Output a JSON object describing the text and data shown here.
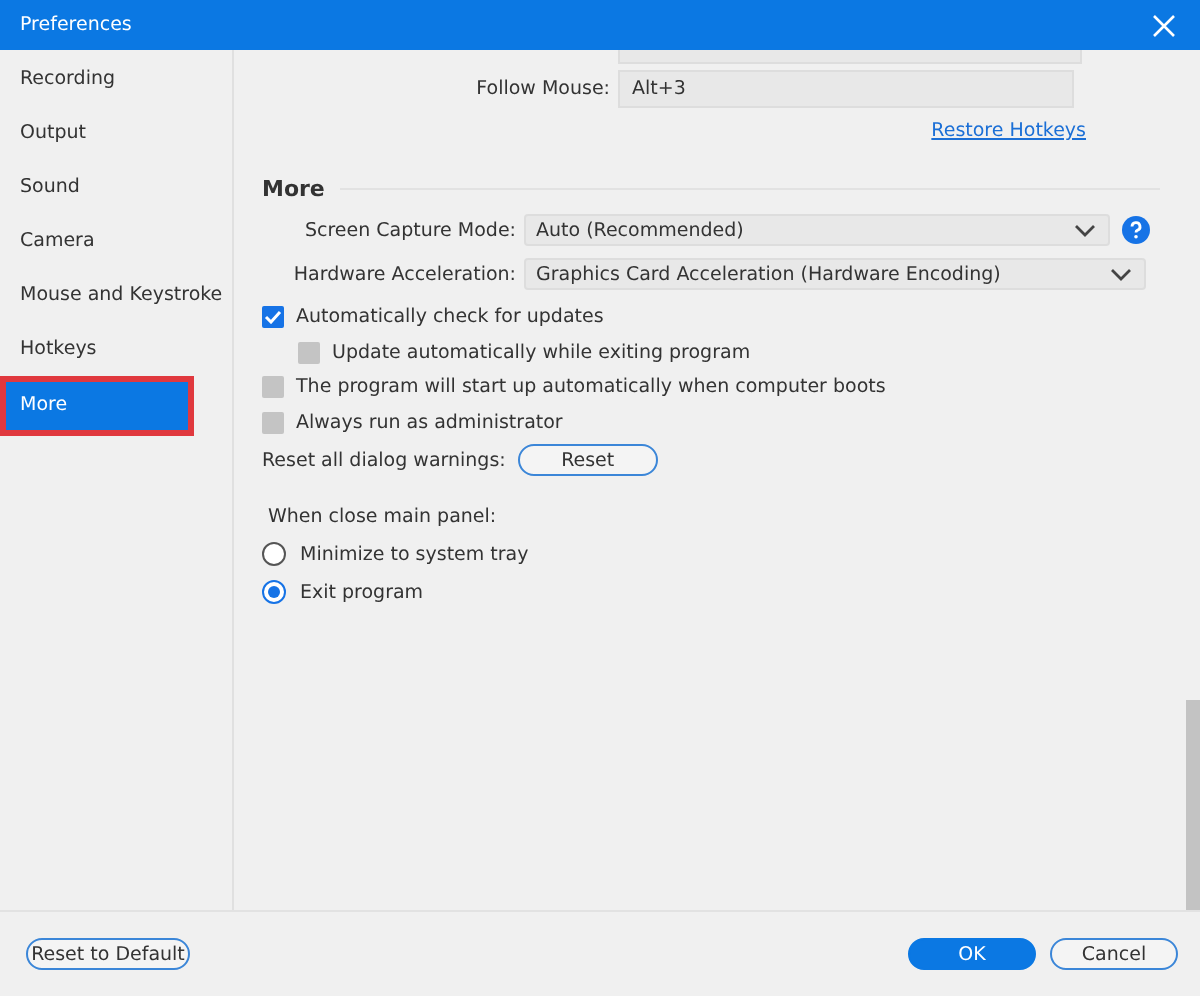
{
  "window": {
    "title": "Preferences"
  },
  "sidebar": {
    "items": [
      {
        "label": "Recording",
        "selected": false
      },
      {
        "label": "Output",
        "selected": false
      },
      {
        "label": "Sound",
        "selected": false
      },
      {
        "label": "Camera",
        "selected": false
      },
      {
        "label": "Mouse and Keystroke",
        "selected": false
      },
      {
        "label": "Hotkeys",
        "selected": false
      },
      {
        "label": "More",
        "selected": true
      }
    ]
  },
  "hotkeys": {
    "follow_mouse": {
      "label": "Follow Mouse:",
      "value": "Alt+3"
    },
    "restore_link": "Restore Hotkeys"
  },
  "more": {
    "heading": "More",
    "dropdowns": [
      {
        "label": "Screen Capture Mode:",
        "value": "Auto (Recommended)",
        "help": true
      },
      {
        "label": "Hardware Acceleration:",
        "value": "Graphics Card Acceleration (Hardware Encoding)",
        "help": false
      }
    ],
    "checkboxes": [
      {
        "label": "Automatically check for updates",
        "checked": true,
        "children": [
          {
            "label": "Update automatically while exiting program",
            "checked": false
          }
        ]
      },
      {
        "label": "The program will start up automatically when computer boots",
        "checked": false
      },
      {
        "label": "Always run as administrator",
        "checked": false
      }
    ],
    "reset_warnings": {
      "label": "Reset all dialog warnings:",
      "button": "Reset"
    },
    "close_label": "When close main panel:",
    "radios": [
      {
        "label": "Minimize to system tray",
        "selected": false
      },
      {
        "label": "Exit program",
        "selected": true
      }
    ]
  },
  "footer": {
    "reset_default": "Reset to Default",
    "ok": "OK",
    "cancel": "Cancel"
  }
}
